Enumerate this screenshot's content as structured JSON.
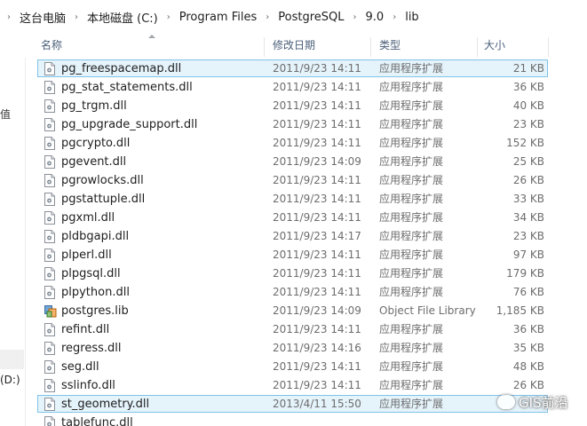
{
  "breadcrumb": [
    "这台电脑",
    "本地磁盘 (C:)",
    "Program Files",
    "PostgreSQL",
    "9.0",
    "lib"
  ],
  "breadcrumb_separator": "›",
  "nav": {
    "partial_glyph": "值",
    "drive_label": "(D:)"
  },
  "columns": {
    "name": "名称",
    "date": "修改日期",
    "type": "类型",
    "size": "大小"
  },
  "files": [
    {
      "name": "pg_freespacemap.dll",
      "date": "2011/9/23 14:11",
      "type": "应用程序扩展",
      "size": "21 KB",
      "icon": "dll-icon",
      "selected": true
    },
    {
      "name": "pg_stat_statements.dll",
      "date": "2011/9/23 14:11",
      "type": "应用程序扩展",
      "size": "36 KB",
      "icon": "dll-icon"
    },
    {
      "name": "pg_trgm.dll",
      "date": "2011/9/23 14:11",
      "type": "应用程序扩展",
      "size": "40 KB",
      "icon": "dll-icon"
    },
    {
      "name": "pg_upgrade_support.dll",
      "date": "2011/9/23 14:11",
      "type": "应用程序扩展",
      "size": "23 KB",
      "icon": "dll-icon"
    },
    {
      "name": "pgcrypto.dll",
      "date": "2011/9/23 14:11",
      "type": "应用程序扩展",
      "size": "152 KB",
      "icon": "dll-icon"
    },
    {
      "name": "pgevent.dll",
      "date": "2011/9/23 14:09",
      "type": "应用程序扩展",
      "size": "25 KB",
      "icon": "dll-icon"
    },
    {
      "name": "pgrowlocks.dll",
      "date": "2011/9/23 14:11",
      "type": "应用程序扩展",
      "size": "26 KB",
      "icon": "dll-icon"
    },
    {
      "name": "pgstattuple.dll",
      "date": "2011/9/23 14:11",
      "type": "应用程序扩展",
      "size": "33 KB",
      "icon": "dll-icon"
    },
    {
      "name": "pgxml.dll",
      "date": "2011/9/23 14:11",
      "type": "应用程序扩展",
      "size": "34 KB",
      "icon": "dll-icon"
    },
    {
      "name": "pldbgapi.dll",
      "date": "2011/9/23 14:17",
      "type": "应用程序扩展",
      "size": "23 KB",
      "icon": "dll-icon"
    },
    {
      "name": "plperl.dll",
      "date": "2011/9/23 14:11",
      "type": "应用程序扩展",
      "size": "97 KB",
      "icon": "dll-icon"
    },
    {
      "name": "plpgsql.dll",
      "date": "2011/9/23 14:11",
      "type": "应用程序扩展",
      "size": "179 KB",
      "icon": "dll-icon"
    },
    {
      "name": "plpython.dll",
      "date": "2011/9/23 14:11",
      "type": "应用程序扩展",
      "size": "76 KB",
      "icon": "dll-icon"
    },
    {
      "name": "postgres.lib",
      "date": "2011/9/23 14:09",
      "type": "Object File Library",
      "size": "1,185 KB",
      "icon": "lib-icon"
    },
    {
      "name": "refint.dll",
      "date": "2011/9/23 14:11",
      "type": "应用程序扩展",
      "size": "36 KB",
      "icon": "dll-icon"
    },
    {
      "name": "regress.dll",
      "date": "2011/9/23 14:16",
      "type": "应用程序扩展",
      "size": "35 KB",
      "icon": "dll-icon"
    },
    {
      "name": "seg.dll",
      "date": "2011/9/23 14:11",
      "type": "应用程序扩展",
      "size": "48 KB",
      "icon": "dll-icon"
    },
    {
      "name": "sslinfo.dll",
      "date": "2011/9/23 14:11",
      "type": "应用程序扩展",
      "size": "26 KB",
      "icon": "dll-icon"
    },
    {
      "name": "st_geometry.dll",
      "date": "2013/4/11 15:50",
      "type": "应用程序扩展",
      "size": "",
      "icon": "dll-icon",
      "selected": true
    },
    {
      "name": "tablefunc.dll",
      "date": "",
      "type": "",
      "size": "",
      "icon": "dll-icon"
    }
  ],
  "watermark": "GIS前沿",
  "colors": {
    "selection_bg": "#e5f3fb",
    "selection_border": "#7fc3e8",
    "header_text": "#4c607a",
    "secondary_text": "#6d6d6d"
  }
}
